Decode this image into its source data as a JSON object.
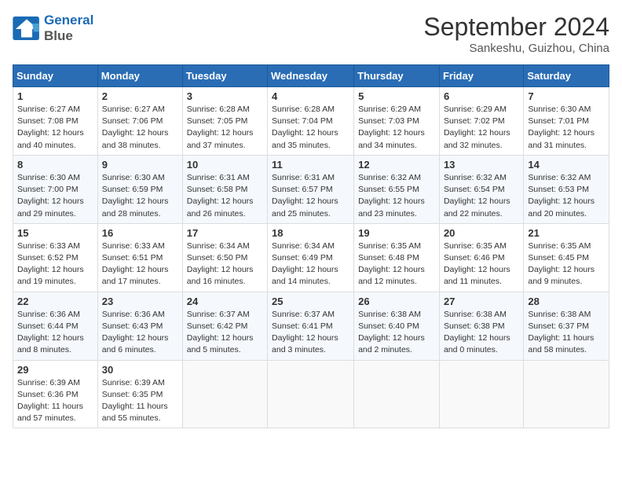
{
  "header": {
    "logo_line1": "General",
    "logo_line2": "Blue",
    "month": "September 2024",
    "location": "Sankeshu, Guizhou, China"
  },
  "days_of_week": [
    "Sunday",
    "Monday",
    "Tuesday",
    "Wednesday",
    "Thursday",
    "Friday",
    "Saturday"
  ],
  "weeks": [
    [
      {
        "day": "1",
        "info": "Sunrise: 6:27 AM\nSunset: 7:08 PM\nDaylight: 12 hours\nand 40 minutes."
      },
      {
        "day": "2",
        "info": "Sunrise: 6:27 AM\nSunset: 7:06 PM\nDaylight: 12 hours\nand 38 minutes."
      },
      {
        "day": "3",
        "info": "Sunrise: 6:28 AM\nSunset: 7:05 PM\nDaylight: 12 hours\nand 37 minutes."
      },
      {
        "day": "4",
        "info": "Sunrise: 6:28 AM\nSunset: 7:04 PM\nDaylight: 12 hours\nand 35 minutes."
      },
      {
        "day": "5",
        "info": "Sunrise: 6:29 AM\nSunset: 7:03 PM\nDaylight: 12 hours\nand 34 minutes."
      },
      {
        "day": "6",
        "info": "Sunrise: 6:29 AM\nSunset: 7:02 PM\nDaylight: 12 hours\nand 32 minutes."
      },
      {
        "day": "7",
        "info": "Sunrise: 6:30 AM\nSunset: 7:01 PM\nDaylight: 12 hours\nand 31 minutes."
      }
    ],
    [
      {
        "day": "8",
        "info": "Sunrise: 6:30 AM\nSunset: 7:00 PM\nDaylight: 12 hours\nand 29 minutes."
      },
      {
        "day": "9",
        "info": "Sunrise: 6:30 AM\nSunset: 6:59 PM\nDaylight: 12 hours\nand 28 minutes."
      },
      {
        "day": "10",
        "info": "Sunrise: 6:31 AM\nSunset: 6:58 PM\nDaylight: 12 hours\nand 26 minutes."
      },
      {
        "day": "11",
        "info": "Sunrise: 6:31 AM\nSunset: 6:57 PM\nDaylight: 12 hours\nand 25 minutes."
      },
      {
        "day": "12",
        "info": "Sunrise: 6:32 AM\nSunset: 6:55 PM\nDaylight: 12 hours\nand 23 minutes."
      },
      {
        "day": "13",
        "info": "Sunrise: 6:32 AM\nSunset: 6:54 PM\nDaylight: 12 hours\nand 22 minutes."
      },
      {
        "day": "14",
        "info": "Sunrise: 6:32 AM\nSunset: 6:53 PM\nDaylight: 12 hours\nand 20 minutes."
      }
    ],
    [
      {
        "day": "15",
        "info": "Sunrise: 6:33 AM\nSunset: 6:52 PM\nDaylight: 12 hours\nand 19 minutes."
      },
      {
        "day": "16",
        "info": "Sunrise: 6:33 AM\nSunset: 6:51 PM\nDaylight: 12 hours\nand 17 minutes."
      },
      {
        "day": "17",
        "info": "Sunrise: 6:34 AM\nSunset: 6:50 PM\nDaylight: 12 hours\nand 16 minutes."
      },
      {
        "day": "18",
        "info": "Sunrise: 6:34 AM\nSunset: 6:49 PM\nDaylight: 12 hours\nand 14 minutes."
      },
      {
        "day": "19",
        "info": "Sunrise: 6:35 AM\nSunset: 6:48 PM\nDaylight: 12 hours\nand 12 minutes."
      },
      {
        "day": "20",
        "info": "Sunrise: 6:35 AM\nSunset: 6:46 PM\nDaylight: 12 hours\nand 11 minutes."
      },
      {
        "day": "21",
        "info": "Sunrise: 6:35 AM\nSunset: 6:45 PM\nDaylight: 12 hours\nand 9 minutes."
      }
    ],
    [
      {
        "day": "22",
        "info": "Sunrise: 6:36 AM\nSunset: 6:44 PM\nDaylight: 12 hours\nand 8 minutes."
      },
      {
        "day": "23",
        "info": "Sunrise: 6:36 AM\nSunset: 6:43 PM\nDaylight: 12 hours\nand 6 minutes."
      },
      {
        "day": "24",
        "info": "Sunrise: 6:37 AM\nSunset: 6:42 PM\nDaylight: 12 hours\nand 5 minutes."
      },
      {
        "day": "25",
        "info": "Sunrise: 6:37 AM\nSunset: 6:41 PM\nDaylight: 12 hours\nand 3 minutes."
      },
      {
        "day": "26",
        "info": "Sunrise: 6:38 AM\nSunset: 6:40 PM\nDaylight: 12 hours\nand 2 minutes."
      },
      {
        "day": "27",
        "info": "Sunrise: 6:38 AM\nSunset: 6:38 PM\nDaylight: 12 hours\nand 0 minutes."
      },
      {
        "day": "28",
        "info": "Sunrise: 6:38 AM\nSunset: 6:37 PM\nDaylight: 11 hours\nand 58 minutes."
      }
    ],
    [
      {
        "day": "29",
        "info": "Sunrise: 6:39 AM\nSunset: 6:36 PM\nDaylight: 11 hours\nand 57 minutes."
      },
      {
        "day": "30",
        "info": "Sunrise: 6:39 AM\nSunset: 6:35 PM\nDaylight: 11 hours\nand 55 minutes."
      },
      {
        "day": "",
        "info": ""
      },
      {
        "day": "",
        "info": ""
      },
      {
        "day": "",
        "info": ""
      },
      {
        "day": "",
        "info": ""
      },
      {
        "day": "",
        "info": ""
      }
    ]
  ]
}
